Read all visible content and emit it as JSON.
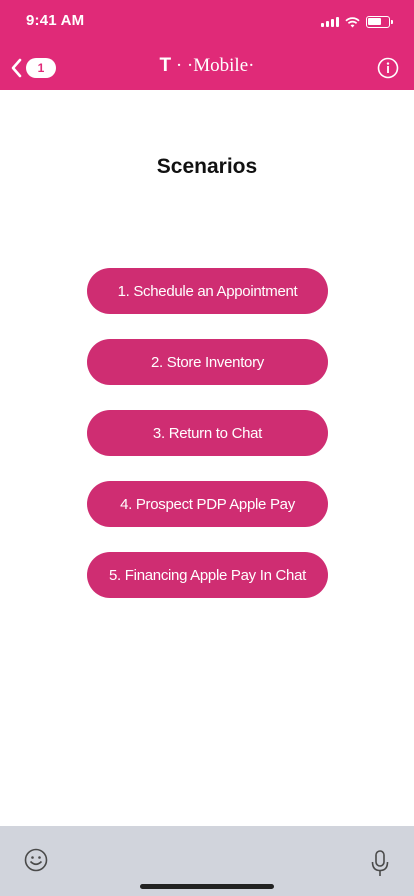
{
  "status_bar": {
    "time": "9:41 AM"
  },
  "nav": {
    "back_badge": "1",
    "brand_t": "T",
    "brand_rest": " · ·Mobile·"
  },
  "main": {
    "title": "Scenarios",
    "scenarios": [
      {
        "label": "1. Schedule an Appointment"
      },
      {
        "label": "2. Store Inventory"
      },
      {
        "label": "3. Return to Chat"
      },
      {
        "label": "4. Prospect PDP Apple Pay"
      },
      {
        "label": "5. Financing Apple Pay In Chat"
      }
    ]
  },
  "colors": {
    "header": "#e02a78",
    "button": "#cf2d72",
    "bottom_bar": "#d1d4dc"
  },
  "icons": {
    "back": "chevron-left-icon",
    "info": "info-icon",
    "emoji": "smiley-icon",
    "mic": "microphone-icon",
    "battery": "battery-icon",
    "wifi": "wifi-icon",
    "signal": "signal-icon"
  }
}
